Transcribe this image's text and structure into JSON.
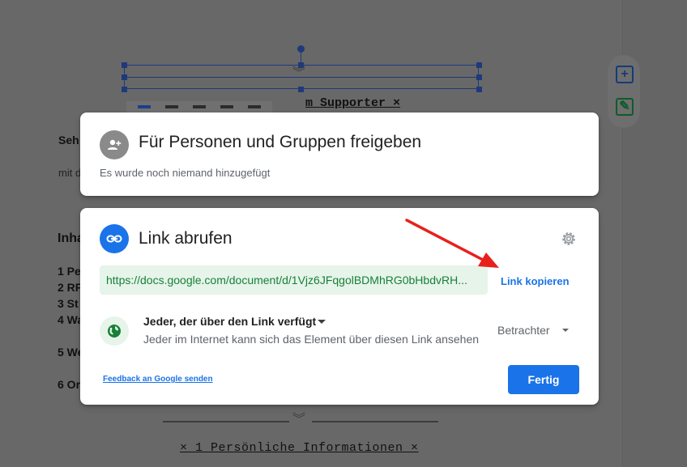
{
  "background_doc": {
    "title_box_text": "m Supporter ×",
    "left_lines": [
      "Seh",
      "mit d",
      "Inha",
      "1 Pe",
      "2 RF",
      "3 St",
      "4 Wa",
      "5 We",
      "6 Or"
    ],
    "footer_text": "× 1 Persönliche Informationen ×"
  },
  "share_dialog": {
    "title": "Für Personen und Gruppen freigeben",
    "subtitle": "Es wurde noch niemand hinzugefügt",
    "icon": "person-add-icon"
  },
  "link_dialog": {
    "title": "Link abrufen",
    "icon": "link-icon",
    "url": "https://docs.google.com/document/d/1Vjz6JFqgolBDMhRG0bHbdvRH...",
    "copy_label": "Link kopieren",
    "access_title": "Jeder, der über den Link verfügt",
    "access_description": "Jeder im Internet kann sich das Element über diesen Link ansehen",
    "role": "Betrachter",
    "feedback_label": "Feedback an Google senden",
    "done_label": "Fertig"
  },
  "colors": {
    "accent": "#1a73e8",
    "url_bg": "#e6f4ea",
    "url_text": "#188038",
    "annotation_arrow": "#e8201c"
  }
}
